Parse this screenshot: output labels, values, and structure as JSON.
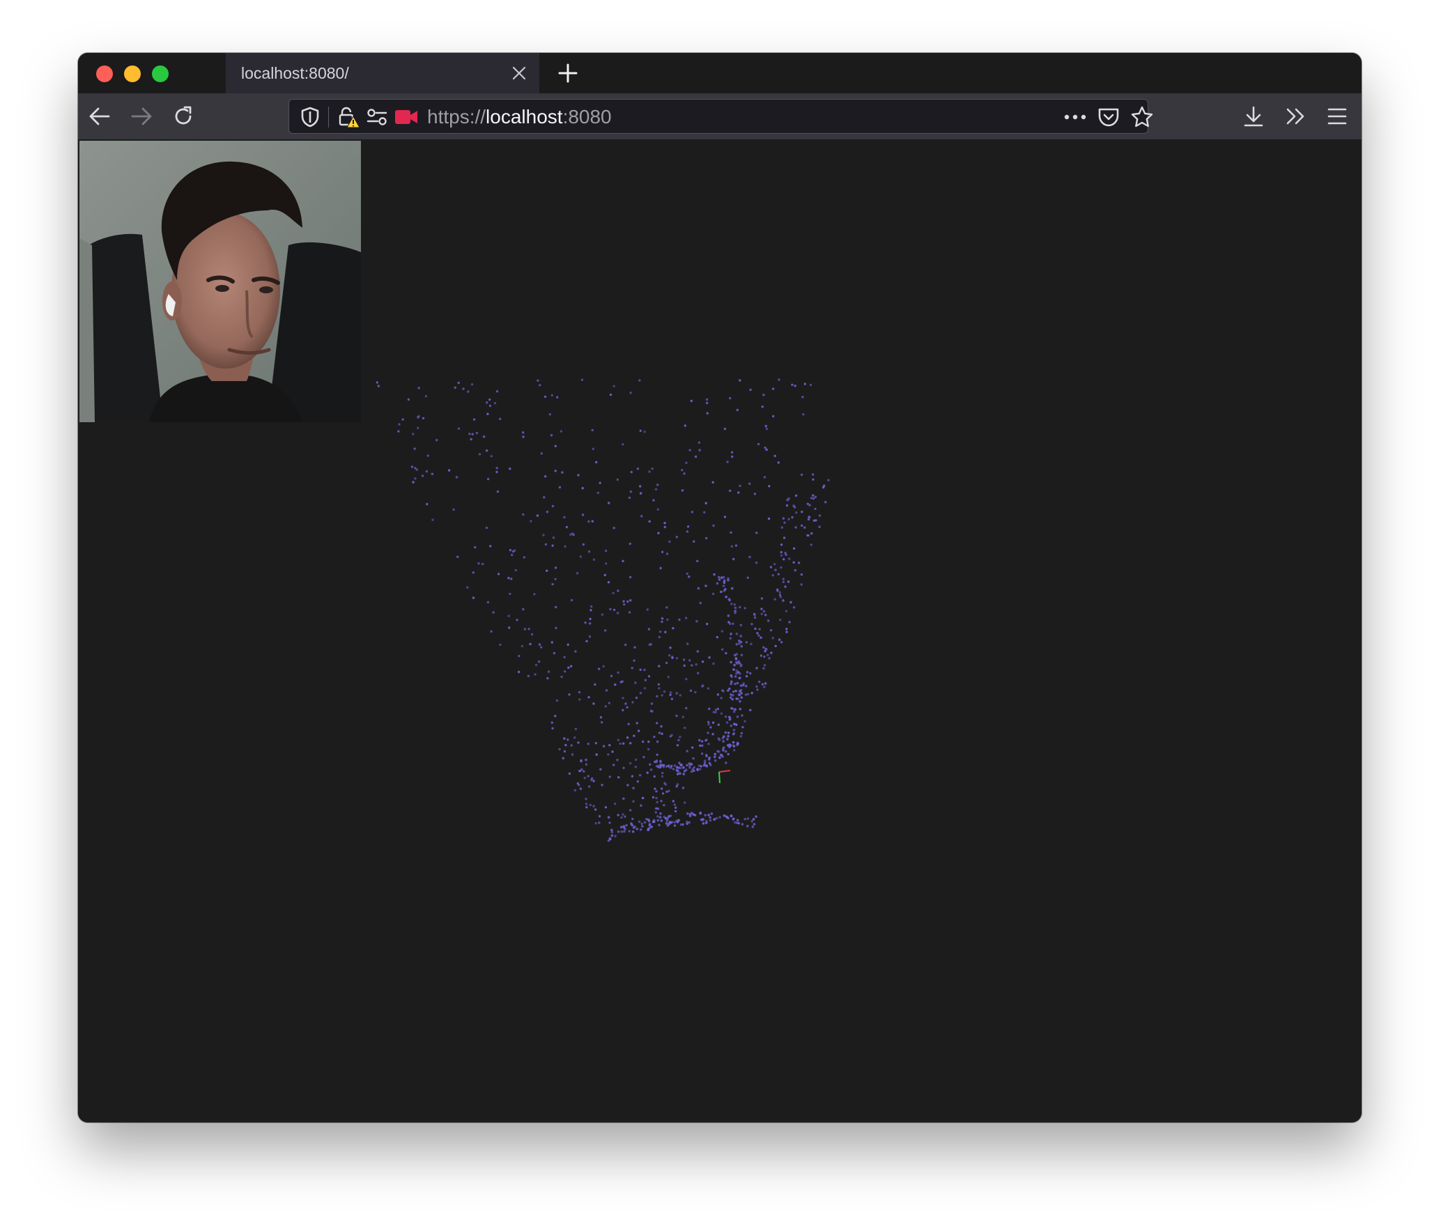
{
  "window": {
    "traffic_lights": [
      "close",
      "minimize",
      "maximize"
    ],
    "colors": {
      "close": "#fe5f57",
      "minimize": "#febc2e",
      "maximize": "#28c840"
    }
  },
  "tab": {
    "title": "localhost:8080/",
    "close_icon": "close-icon"
  },
  "toolbar": {
    "back_icon": "back-arrow-icon",
    "forward_icon": "forward-arrow-icon",
    "reload_icon": "reload-icon",
    "downloads_icon": "download-icon",
    "overflow_icon": "chevron-double-right-icon",
    "menu_icon": "hamburger-menu-icon"
  },
  "urlbar": {
    "scheme": "https://",
    "host": "localhost",
    "port": ":8080",
    "icons": [
      "shield-icon",
      "lock-warning-icon",
      "permissions-icon",
      "camera-icon",
      "more-dots-icon",
      "pocket-icon",
      "star-icon"
    ],
    "camera_color": "#e22850"
  },
  "page": {
    "background": "#1c1c1c",
    "video_feed": "webcam-video",
    "point_cloud": {
      "point_color": "#6f63d8",
      "axis_colors": {
        "x": "#e23a3a",
        "y": "#3ad04a"
      }
    }
  }
}
